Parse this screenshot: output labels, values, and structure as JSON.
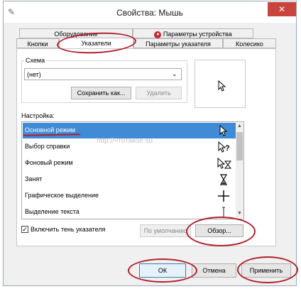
{
  "window": {
    "title": "Свойства: Мышь",
    "close_label": "✕"
  },
  "tabs": {
    "back_row": [
      "Оборудование",
      "Параметры устройства"
    ],
    "front_row": [
      "Кнопки",
      "Указатели",
      "Параметры указателя",
      "Колесико"
    ]
  },
  "scheme": {
    "group_label": "Схема",
    "selected": "(нет)",
    "save_as_label": "Сохранить как...",
    "delete_label": "Удалить"
  },
  "customize": {
    "label": "Настройка:",
    "items": [
      {
        "label": "Основной режим",
        "cursor": "arrow-cursor-icon",
        "selected": true
      },
      {
        "label": "Выбор справки",
        "cursor": "help-cursor-icon",
        "selected": false
      },
      {
        "label": "Фоновый режим",
        "cursor": "working-in-background-cursor-icon",
        "selected": false
      },
      {
        "label": "Занят",
        "cursor": "busy-hourglass-icon",
        "selected": false
      },
      {
        "label": "Графическое выделение",
        "cursor": "precision-cross-icon",
        "selected": false
      },
      {
        "label": "Выделение текста",
        "cursor": "text-ibeam-icon",
        "selected": false
      }
    ]
  },
  "shadow": {
    "label": "Включить тень указателя",
    "checked": true
  },
  "buttons": {
    "default_label": "По умолчанию",
    "browse_label": "Обзор...",
    "ok_label": "ОК",
    "cancel_label": "Отмена",
    "apply_label": "Применить"
  },
  "watermark": "http://чтотакое.su",
  "colors": {
    "selection": "#3f8bd6",
    "annotation": "#b0202b",
    "close": "#c9443c"
  }
}
